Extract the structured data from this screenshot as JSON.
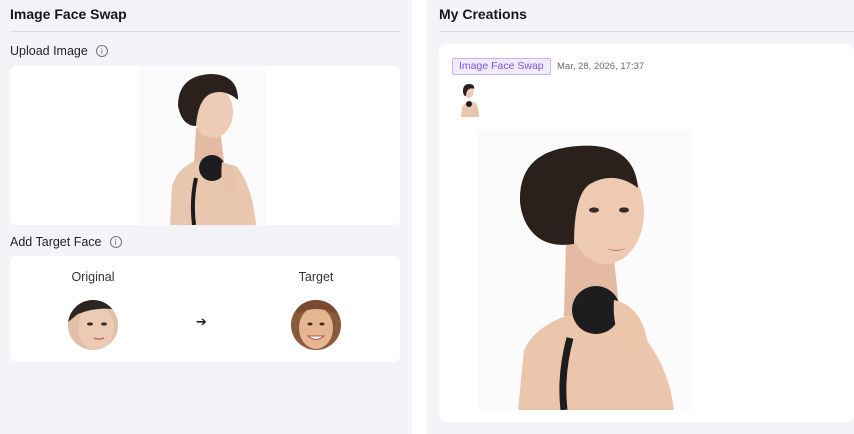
{
  "left_panel": {
    "title": "Image Face Swap",
    "upload_label": "Upload Image",
    "target_label": "Add Target Face",
    "original_label": "Original",
    "target_face_label": "Target",
    "info_glyph": "i",
    "arrow_glyph": "➔"
  },
  "right_panel": {
    "title": "My Creations",
    "creation": {
      "tag": "Image Face Swap",
      "timestamp": "Mar, 28, 2026, 17:37"
    }
  },
  "colors": {
    "panel_bg": "#f4f4f8",
    "tag_border": "#c8b3f2",
    "tag_bg": "#f1ebfd",
    "tag_text": "#7a55d6"
  },
  "icons": [
    "info-icon",
    "arrow-right-icon"
  ]
}
